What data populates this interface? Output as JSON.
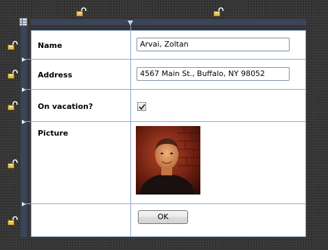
{
  "form": {
    "fields": {
      "name_label": "Name",
      "name_value": "Arvai, Zoltan",
      "address_label": "Address",
      "address_value": "4567 Main St., Buffalo, NY 98052",
      "vacation_label": "On vacation?",
      "vacation_checked": true,
      "picture_label": "Picture"
    },
    "ok_label": "OK"
  },
  "designer": {
    "column_locks": [
      "lock-icon",
      "lock-icon"
    ],
    "row_locks": [
      "lock-icon",
      "lock-icon",
      "lock-icon",
      "lock-icon",
      "lock-icon"
    ],
    "grid_icon": "grid-icon"
  },
  "colors": {
    "gridline": "#8fa6d0",
    "ruler": "#3b4559",
    "lock_body": "#e3c04a"
  }
}
